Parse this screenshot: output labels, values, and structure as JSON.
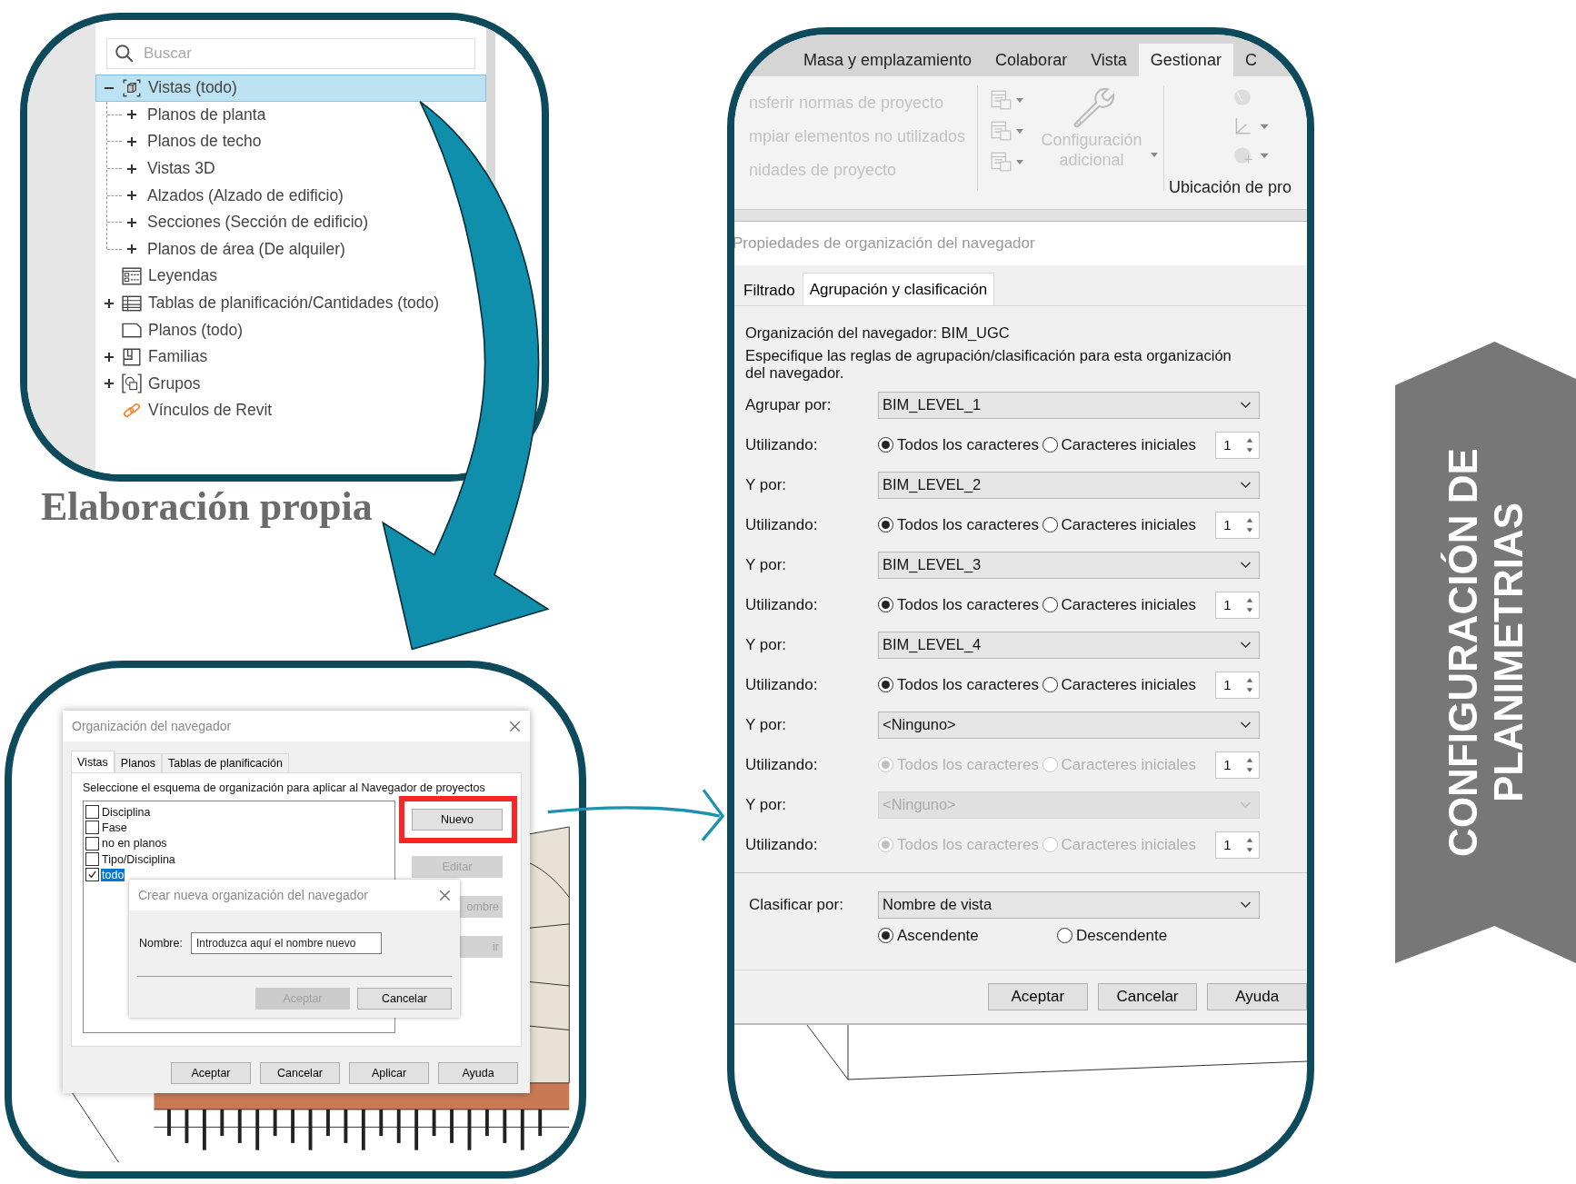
{
  "browser": {
    "search": {
      "placeholder": "Buscar"
    },
    "tree": [
      {
        "label": "Vistas (todo)",
        "kind": "views",
        "selected": true,
        "expanded": true,
        "children": [
          {
            "label": "Planos de planta",
            "selected": false,
            "expanded": false
          },
          {
            "label": "Planos de techo",
            "selected": false,
            "expanded": false
          },
          {
            "label": "Vistas 3D",
            "selected": false,
            "expanded": false
          },
          {
            "label": "Alzados (Alzado de edificio)",
            "selected": false,
            "expanded": false
          },
          {
            "label": "Secciones (Sección de edificio)",
            "selected": false,
            "expanded": false
          },
          {
            "label": "Planos de área (De alquiler)",
            "selected": false,
            "expanded": false
          }
        ]
      },
      {
        "label": "Leyendas",
        "kind": "legend",
        "selected": false
      },
      {
        "label": "Tablas de planificación/Cantidades (todo)",
        "kind": "schedule",
        "selected": false,
        "expanded": false
      },
      {
        "label": "Planos (todo)",
        "kind": "sheet",
        "selected": false
      },
      {
        "label": "Familias",
        "kind": "family",
        "selected": false,
        "expanded": false
      },
      {
        "label": "Grupos",
        "kind": "group",
        "selected": false,
        "expanded": false
      },
      {
        "label": "Vínculos de Revit",
        "kind": "link",
        "selected": false
      }
    ]
  },
  "caption": "Elaboración propia",
  "organization_dialog": {
    "title": "Organización del navegador",
    "tabs": [
      {
        "label": "Vistas",
        "selected": true
      },
      {
        "label": "Planos",
        "selected": false
      },
      {
        "label": "Tablas de planificación",
        "selected": false
      }
    ],
    "instruction": "Seleccione el esquema de organización para aplicar al Navegador de proyectos",
    "schemes": [
      {
        "label": "Disciplina",
        "checked": false,
        "selected": false
      },
      {
        "label": "Fase",
        "checked": false,
        "selected": false
      },
      {
        "label": "no en planos",
        "checked": false,
        "selected": false
      },
      {
        "label": "Tipo/Disciplina",
        "checked": false,
        "selected": false
      },
      {
        "label": "todo",
        "checked": true,
        "selected": true
      }
    ],
    "side_buttons": [
      {
        "label": "Nuevo",
        "disabled": false,
        "highlighted": true
      },
      {
        "label": "Editar",
        "disabled": true,
        "highlighted": false
      },
      {
        "label": "ombre",
        "disabled": true,
        "highlighted": false,
        "covered": true
      },
      {
        "label": "ir",
        "disabled": true,
        "highlighted": false,
        "covered": true
      }
    ],
    "buttons": [
      {
        "label": "Aceptar",
        "disabled": false
      },
      {
        "label": "Cancelar",
        "disabled": false
      },
      {
        "label": "Aplicar",
        "disabled": false
      },
      {
        "label": "Ayuda",
        "disabled": false
      }
    ]
  },
  "new_dialog": {
    "title": "Crear nueva organización del navegador",
    "name_label": "Nombre:",
    "name_field": {
      "value": "Introduzca aquí el nombre nuevo"
    },
    "buttons": [
      {
        "label": "Aceptar",
        "disabled": true
      },
      {
        "label": "Cancelar",
        "disabled": false
      }
    ]
  },
  "ribbon": {
    "tabs": [
      {
        "label": "Masa y emplazamiento",
        "selected": false
      },
      {
        "label": "Colaborar",
        "selected": false
      },
      {
        "label": "Vista",
        "selected": false
      },
      {
        "label": "Gestionar",
        "selected": true
      },
      {
        "label": "C",
        "selected": false
      }
    ],
    "commands": [
      {
        "label": "nsferir normas de proyecto",
        "disabled": true
      },
      {
        "label": "mpiar elementos no utilizados",
        "disabled": true
      },
      {
        "label": "nidades de proyecto",
        "disabled": true
      }
    ],
    "settings_button": {
      "label": "Configuración adicional",
      "disabled": true
    },
    "panel_label": "Ubicación de pro"
  },
  "properties_dialog": {
    "title": "Propiedades de organización del navegador",
    "tabs": [
      {
        "label": "Filtrado",
        "selected": false
      },
      {
        "label": "Agrupación y clasificación",
        "selected": true
      }
    ],
    "organization": "Organización del navegador: BIM_UGC",
    "instruction": "Especifique las reglas de agrupación/clasificación para esta organización del navegador.",
    "groups": [
      {
        "label": "Agrupar por:",
        "value": "BIM_LEVEL_1",
        "field_disabled": false,
        "using_label": "Utilizando:",
        "options_disabled": false,
        "options": [
          {
            "label": "Todos los caracteres",
            "selected": true
          },
          {
            "label": "Caracteres iniciales",
            "selected": false
          }
        ],
        "count": "1"
      },
      {
        "label": "Y por:",
        "value": "BIM_LEVEL_2",
        "field_disabled": false,
        "using_label": "Utilizando:",
        "options_disabled": false,
        "options": [
          {
            "label": "Todos los caracteres",
            "selected": true
          },
          {
            "label": "Caracteres iniciales",
            "selected": false
          }
        ],
        "count": "1"
      },
      {
        "label": "Y por:",
        "value": "BIM_LEVEL_3",
        "field_disabled": false,
        "using_label": "Utilizando:",
        "options_disabled": false,
        "options": [
          {
            "label": "Todos los caracteres",
            "selected": true
          },
          {
            "label": "Caracteres iniciales",
            "selected": false
          }
        ],
        "count": "1"
      },
      {
        "label": "Y por:",
        "value": "BIM_LEVEL_4",
        "field_disabled": false,
        "using_label": "Utilizando:",
        "options_disabled": false,
        "options": [
          {
            "label": "Todos los caracteres",
            "selected": true
          },
          {
            "label": "Caracteres iniciales",
            "selected": false
          }
        ],
        "count": "1"
      },
      {
        "label": "Y por:",
        "value": "<Ninguno>",
        "field_disabled": false,
        "using_label": "Utilizando:",
        "options_disabled": true,
        "options": [
          {
            "label": "Todos los caracteres",
            "selected": true
          },
          {
            "label": "Caracteres iniciales",
            "selected": false
          }
        ],
        "count": "1"
      },
      {
        "label": "Y por:",
        "value": "<Ninguno>",
        "field_disabled": true,
        "using_label": "Utilizando:",
        "options_disabled": true,
        "options": [
          {
            "label": "Todos los caracteres",
            "selected": true
          },
          {
            "label": "Caracteres iniciales",
            "selected": false
          }
        ],
        "count": "1"
      }
    ],
    "sort": {
      "label": "Clasificar por:",
      "value": "Nombre de vista",
      "options": [
        {
          "label": "Ascendente",
          "selected": true
        },
        {
          "label": "Descendente",
          "selected": false
        }
      ]
    },
    "buttons": [
      {
        "label": "Aceptar"
      },
      {
        "label": "Cancelar"
      },
      {
        "label": "Ayuda"
      }
    ]
  },
  "banner": {
    "lines": [
      "CONFIGURACIÓN DE",
      "PLANIMETRIAS"
    ]
  }
}
